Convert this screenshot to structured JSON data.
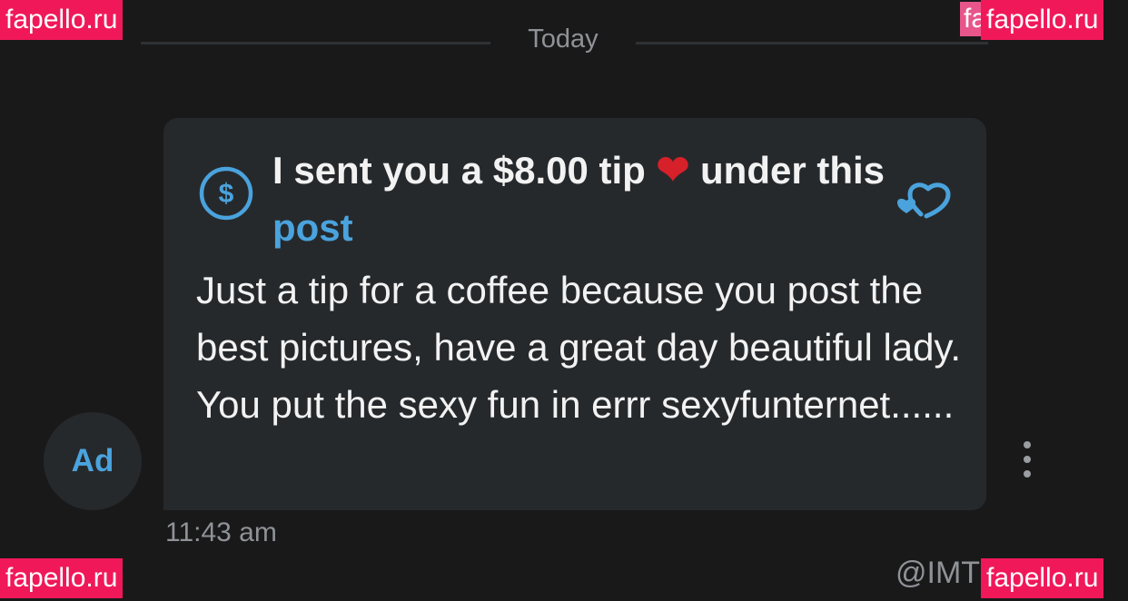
{
  "date_separator": "Today",
  "message": {
    "avatar_initials": "Ad",
    "tip_title_before": "I sent you a $8.00 tip ",
    "tip_title_heart": "❤",
    "tip_title_middle": " under this ",
    "tip_title_link": "post",
    "body": "Just a tip for a coffee because you post the best pictures, have a great day beautiful lady. You put the sexy fun in errr sexyfunternet......",
    "timestamp": "11:43 am",
    "icons": {
      "tip": "dollar-circle-icon",
      "reaction": "hearts-icon",
      "more": "more-vertical-icon"
    }
  },
  "handle": "@IMT",
  "watermarks": [
    "fapello.ru",
    "fapello.ru",
    "fapello.ru",
    "fapello.ru",
    "fa"
  ],
  "colors": {
    "background": "#19191a",
    "bubble": "#26292c",
    "accent": "#4aa3dd",
    "text": "#f2f2f2",
    "muted": "#8f9296",
    "heart": "#d6202a",
    "watermark": "#f01859"
  }
}
